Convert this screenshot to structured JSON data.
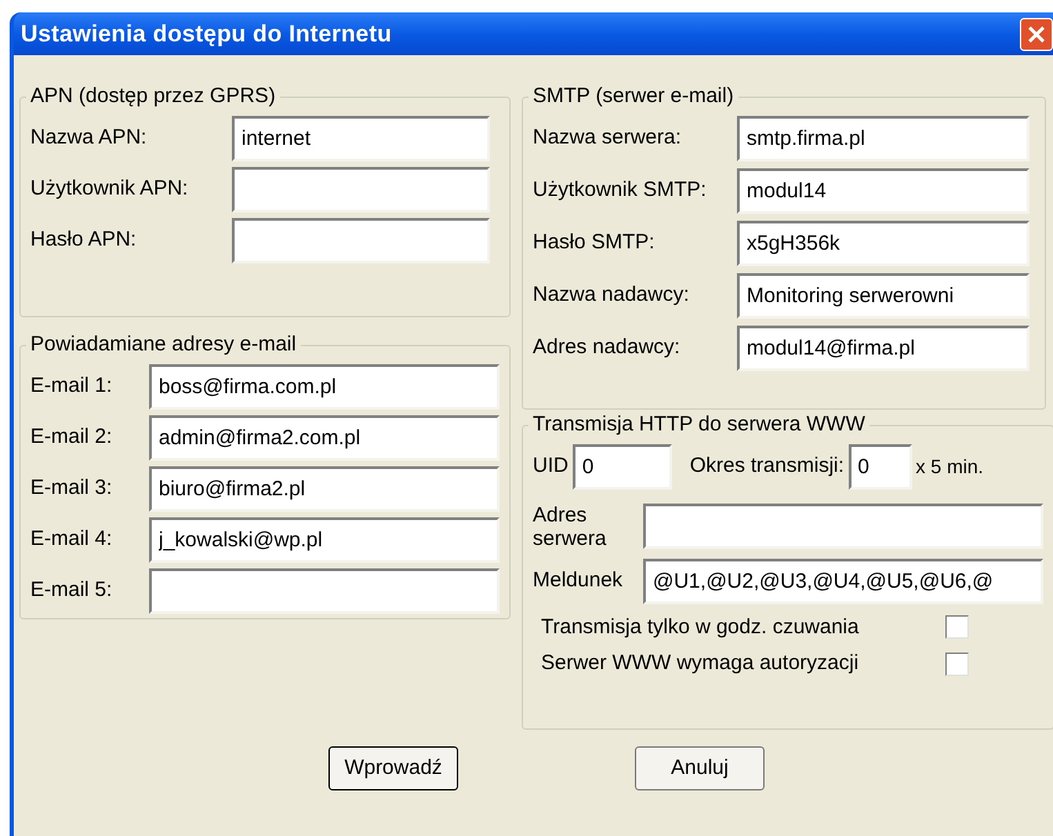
{
  "window": {
    "title": "Ustawienia dostępu do Internetu"
  },
  "apn_group": {
    "title": "APN (dostęp przez GPRS)",
    "fields": [
      {
        "label": "Nazwa APN:",
        "value": "internet"
      },
      {
        "label": "Użytkownik APN:"
      },
      {
        "label": "Hasło APN:"
      }
    ]
  },
  "email_group": {
    "title": "Powiadamiane adresy e-mail",
    "fields": [
      {
        "label": "E-mail 1:",
        "value": "boss@firma.com.pl"
      },
      {
        "label": "E-mail 2:",
        "value": "admin@firma2.com.pl"
      },
      {
        "label": "E-mail 3:",
        "value": "biuro@firma2.pl"
      },
      {
        "label": "E-mail 4:",
        "value": "j_kowalski@wp.pl"
      },
      {
        "label": "E-mail 5:"
      }
    ]
  },
  "smtp_group": {
    "title": "SMTP (serwer e-mail)",
    "fields": [
      {
        "label": "Nazwa serwera:",
        "value": "smtp.firma.pl"
      },
      {
        "label": "Użytkownik SMTP:",
        "value": "modul14"
      },
      {
        "label": "Hasło SMTP:",
        "value": "x5gH356k"
      },
      {
        "label": "Nazwa nadawcy:",
        "value": "Monitoring serwerowni"
      },
      {
        "label": "Adres nadawcy:",
        "value": "modul14@firma.pl"
      }
    ]
  },
  "http_group": {
    "title": "Transmisja HTTP do serwera WWW",
    "uid": {
      "label": "UID",
      "value": "0"
    },
    "period": {
      "label": "Okres transmisji:",
      "value": "0",
      "unit": "x 5 min."
    },
    "server_address": {
      "label": "Adres serwera"
    },
    "report": {
      "label": "Meldunek",
      "value": "@U1,@U2,@U3,@U4,@U5,@U6,@"
    },
    "checkboxes": [
      {
        "label": "Transmisja tylko w godz. czuwania",
        "checked": false
      },
      {
        "label": "Serwer WWW wymaga autoryzacji",
        "checked": false
      }
    ]
  },
  "buttons": [
    "Wprowadź",
    "Anuluj"
  ]
}
